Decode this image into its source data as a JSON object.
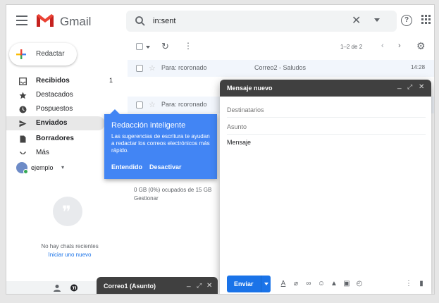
{
  "app": {
    "name": "Gmail"
  },
  "search": {
    "value": "in:sent"
  },
  "compose_button": {
    "label": "Redactar"
  },
  "sidebar": {
    "items": [
      {
        "label": "Recibidos",
        "count": "1",
        "bold": true
      },
      {
        "label": "Destacados",
        "count": "",
        "bold": false
      },
      {
        "label": "Pospuestos",
        "count": "",
        "bold": false
      },
      {
        "label": "Enviados",
        "count": "",
        "bold": true
      },
      {
        "label": "Borradores",
        "count": "",
        "bold": true
      },
      {
        "label": "Más",
        "count": "",
        "bold": false
      }
    ],
    "user": "ejemplo",
    "no_chats": "No hay chats recientes",
    "new_chat": "Iniciar uno nuevo"
  },
  "toolbar": {
    "pagination": "1–2 de 2"
  },
  "mails": [
    {
      "to": "Para: rcoronado",
      "subject": "Correo2 - Saludos",
      "time": "14:28"
    },
    {
      "to": "Para: rcoronado",
      "subject": "",
      "time": ""
    }
  ],
  "storage": {
    "usage": "0 GB (0%) ocupados de 15 GB",
    "manage": "Gestionar"
  },
  "tooltip": {
    "title": "Redacción inteligente",
    "body": "Las sugerencias de escritura te ayudan a redactar los correos electrónicos más rápido.",
    "accept": "Entendido",
    "disable": "Desactivar"
  },
  "compose": {
    "title": "Mensaje nuevo",
    "to_placeholder": "Destinatarios",
    "subject_placeholder": "Asunto",
    "body_placeholder": "Mensaje",
    "send": "Enviar"
  },
  "minimized_compose": {
    "title": "Correo1 (Asunto)"
  },
  "colors": {
    "accent": "#1a73e8",
    "tooltip": "#4285f4",
    "dark_header": "#404040"
  }
}
